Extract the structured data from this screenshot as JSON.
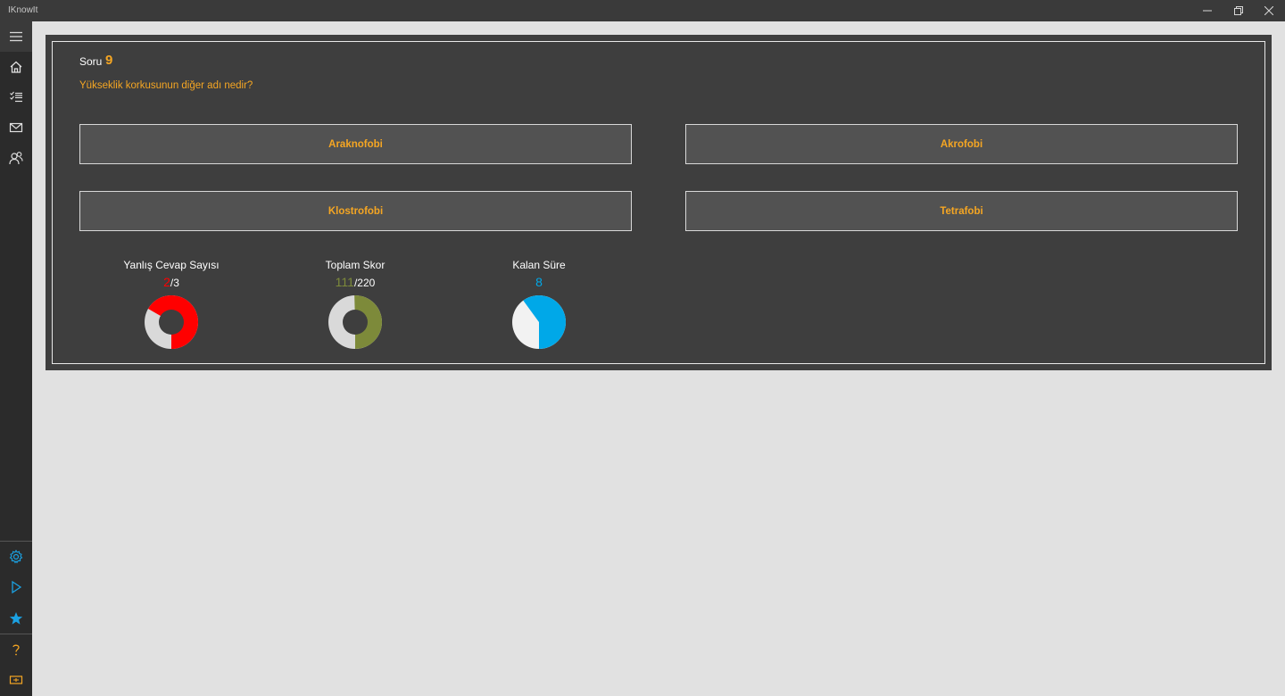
{
  "window": {
    "title": "IKnowIt"
  },
  "sidebar": {
    "items": [
      {
        "icon": "hamburger-icon"
      },
      {
        "icon": "home-icon"
      },
      {
        "icon": "checklist-icon"
      },
      {
        "icon": "mail-icon"
      },
      {
        "icon": "people-icon"
      }
    ],
    "bottom_items": [
      {
        "icon": "gear-icon"
      },
      {
        "icon": "play-icon"
      },
      {
        "icon": "star-icon"
      },
      {
        "icon": "help-icon"
      },
      {
        "icon": "feedback-icon"
      }
    ]
  },
  "quiz": {
    "question_label": "Soru",
    "question_number": "9",
    "question_text": "Yükseklik korkusunun diğer adı nedir?",
    "answers": [
      "Araknofobi",
      "Akrofobi",
      "Klostrofobi",
      "Tetrafobi"
    ]
  },
  "stats": {
    "wrong": {
      "title": "Yanlış Cevap Sayısı",
      "value": "2",
      "total": "/3",
      "fraction": 0.6667,
      "color": "#ff0000"
    },
    "score": {
      "title": "Toplam Skor",
      "value": "111",
      "total": "/220",
      "fraction": 0.5045,
      "color": "#7d8a3a"
    },
    "time": {
      "title": "Kalan Süre",
      "value": "8",
      "fraction": 0.6,
      "color": "#00a8e8"
    }
  },
  "colors": {
    "accent": "#f5a623",
    "sidebar_accent": "#1ba1e2"
  }
}
